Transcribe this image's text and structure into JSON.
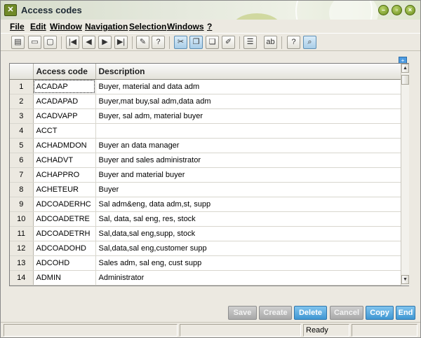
{
  "window": {
    "title": "Access codes",
    "icon": "app-logo-icon"
  },
  "menu": [
    {
      "label": "File"
    },
    {
      "label": "Edit"
    },
    {
      "label": "Window"
    },
    {
      "label": "Navigation"
    },
    {
      "label": "Selection"
    },
    {
      "label": "Windows"
    },
    {
      "label": "?"
    }
  ],
  "grid": {
    "columns": [
      "Access code",
      "Description"
    ],
    "rows": [
      {
        "n": "1",
        "code": "ACADAP",
        "desc": "Buyer, material and data adm"
      },
      {
        "n": "2",
        "code": "ACADAPAD",
        "desc": "Buyer,mat buy,sal adm,data adm"
      },
      {
        "n": "3",
        "code": "ACADVAPP",
        "desc": "Buyer, sal adm, material buyer"
      },
      {
        "n": "4",
        "code": "ACCT",
        "desc": ""
      },
      {
        "n": "5",
        "code": "ACHADMDON",
        "desc": "Buyer an data manager"
      },
      {
        "n": "6",
        "code": "ACHADVT",
        "desc": "Buyer and sales administrator"
      },
      {
        "n": "7",
        "code": "ACHAPPRO",
        "desc": "Buyer and material buyer"
      },
      {
        "n": "8",
        "code": "ACHETEUR",
        "desc": "Buyer"
      },
      {
        "n": "9",
        "code": "ADCOADERHC",
        "desc": "Sal adm&eng, data adm,st, supp"
      },
      {
        "n": "10",
        "code": "ADCOADETRE",
        "desc": "Sal, data, sal eng, res, stock"
      },
      {
        "n": "11",
        "code": "ADCOADETRH",
        "desc": "Sal,data,sal eng,supp, stock"
      },
      {
        "n": "12",
        "code": "ADCOADOHD",
        "desc": "Sal,data,sal eng,customer supp"
      },
      {
        "n": "13",
        "code": "ADCOHD",
        "desc": "Sales adm, sal eng, cust supp"
      },
      {
        "n": "14",
        "code": "ADMIN",
        "desc": "Administrator"
      }
    ]
  },
  "actions": {
    "save": "Save",
    "create": "Create",
    "delete": "Delete",
    "cancel": "Cancel",
    "copy": "Copy",
    "end": "End"
  },
  "status": {
    "text": "Ready"
  },
  "colors": {
    "accent": "#3f97d3",
    "title_green": "#6a8d1a",
    "disabled": "#a9a9a9"
  }
}
